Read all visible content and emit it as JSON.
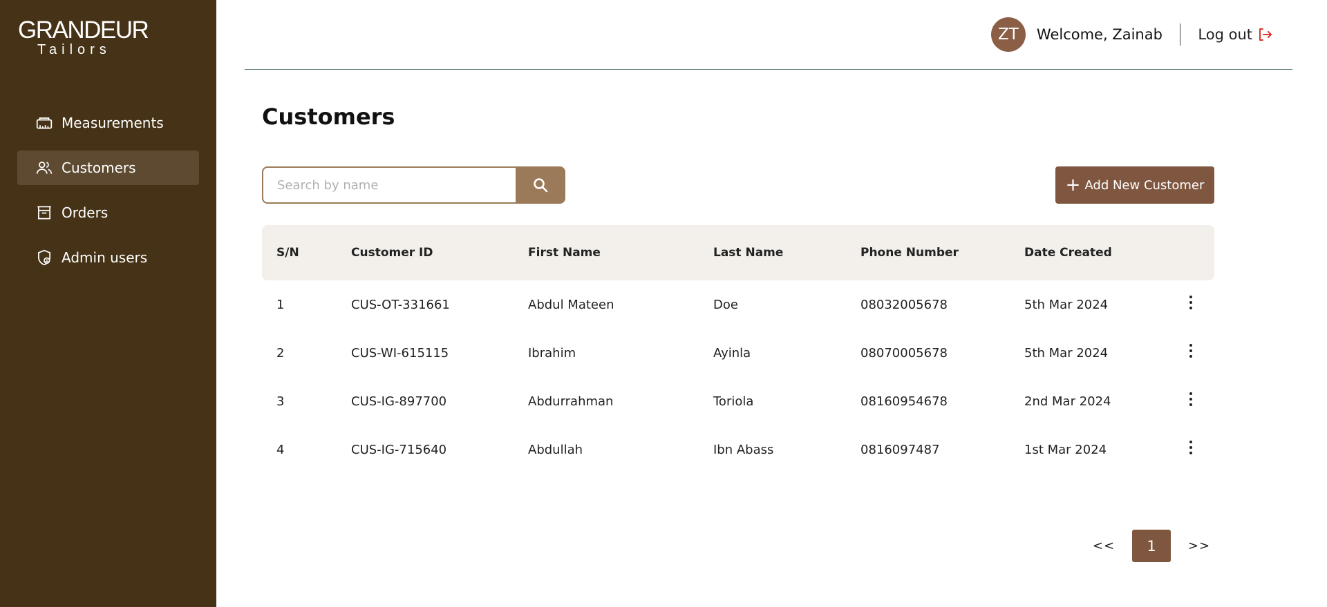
{
  "brand": {
    "name": "GRANDEUR",
    "sub": "Tailors"
  },
  "sidebar": {
    "items": [
      {
        "label": "Measurements",
        "icon": "measure-icon",
        "active": false
      },
      {
        "label": "Customers",
        "icon": "users-icon",
        "active": true
      },
      {
        "label": "Orders",
        "icon": "box-icon",
        "active": false
      },
      {
        "label": "Admin users",
        "icon": "shield-user-icon",
        "active": false
      }
    ]
  },
  "header": {
    "avatar_initials": "ZT",
    "welcome": "Welcome, Zainab",
    "logout": "Log out"
  },
  "main": {
    "title": "Customers",
    "search_placeholder": "Search by name",
    "add_button": "Add New Customer"
  },
  "table": {
    "columns": [
      "S/N",
      "Customer ID",
      "First Name",
      "Last Name",
      "Phone Number",
      "Date Created"
    ],
    "rows": [
      [
        "1",
        "CUS-OT-331661",
        "Abdul Mateen",
        "Doe",
        "08032005678",
        "5th Mar 2024"
      ],
      [
        "2",
        "CUS-WI-615115",
        "Ibrahim",
        "Ayinla",
        "08070005678",
        "5th Mar 2024"
      ],
      [
        "3",
        "CUS-IG-897700",
        "Abdurrahman",
        "Toriola",
        "08160954678",
        "2nd Mar 2024"
      ],
      [
        "4",
        "CUS-IG-715640",
        "Abdullah",
        "Ibn Abass",
        "0816097487",
        "1st Mar 2024"
      ]
    ]
  },
  "pagination": {
    "prev": "<<",
    "current": "1",
    "next": ">>"
  },
  "colors": {
    "sidebar": "#463317",
    "accent": "#7f5740",
    "search_button": "#9b7a5a",
    "logout_icon": "#d9362b"
  }
}
